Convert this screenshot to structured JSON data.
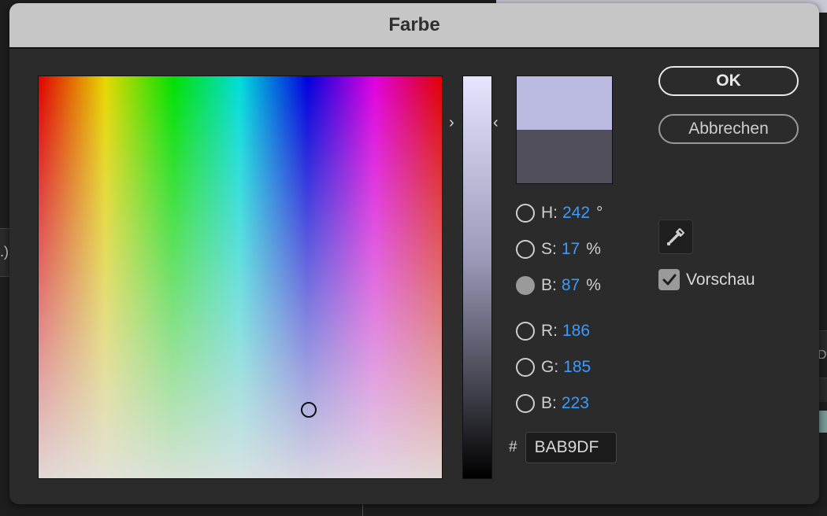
{
  "dialog": {
    "title": "Farbe"
  },
  "hsb": {
    "h": {
      "label": "H:",
      "value": "242",
      "unit": "°"
    },
    "s": {
      "label": "S:",
      "value": "17",
      "unit": "%"
    },
    "b": {
      "label": "B:",
      "value": "87",
      "unit": "%"
    }
  },
  "rgb": {
    "r": {
      "label": "R:",
      "value": "186"
    },
    "g": {
      "label": "G:",
      "value": "185"
    },
    "b": {
      "label": "B:",
      "value": "223"
    }
  },
  "hex": {
    "hash": "#",
    "value": "BAB9DF"
  },
  "buttons": {
    "ok": "OK",
    "cancel": "Abbrechen"
  },
  "preview": {
    "label": "Vorschau",
    "checked": true
  },
  "colors": {
    "new_swatch": "#BAB9DF",
    "old_swatch": "#4F4E5A",
    "accent_value": "#3A9BFF"
  },
  "icons": {
    "eyedropper": "eyedropper-icon",
    "check": "checkmark-icon"
  },
  "background": {
    "left_fragment": ".)",
    "right_fragment": "Df"
  }
}
